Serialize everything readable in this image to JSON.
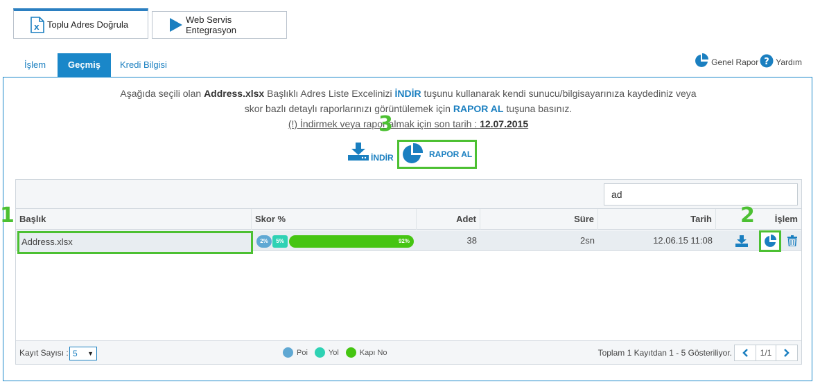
{
  "top_buttons": {
    "bulk_label": "Toplu Adres Doğrula",
    "webservice_label": "Web Servis Entegrasyon"
  },
  "tabs": [
    {
      "label": "İşlem"
    },
    {
      "label": "Geçmiş",
      "active": true
    },
    {
      "label": "Kredi Bilgisi"
    }
  ],
  "top_right": {
    "general_report": "Genel Rapor",
    "help": "Yardım"
  },
  "info": {
    "line1_a": "Aşağıda seçili olan ",
    "line1_file": "Address.xlsx",
    "line1_b": " Başlıklı Adres Liste Excelinizi ",
    "line1_indir": "İNDİR",
    "line1_c": " tuşunu kullanarak kendi sunucu/bilgisayarınıza kaydediniz veya",
    "line2_a": "skor bazlı detaylı raporlarınızı görüntülemek için ",
    "line2_rapor": "RAPOR AL",
    "line2_b": " tuşuna basınız.",
    "line3_a": "(!) İndirmek veya rapor almak için son tarih : ",
    "line3_date": "12.07.2015"
  },
  "actions": {
    "indir_label": "İNDİR",
    "rapor_label": "RAPOR AL"
  },
  "markers": {
    "one": "1",
    "two": "2",
    "three": "3"
  },
  "search": {
    "value": "ad"
  },
  "table": {
    "headers": {
      "baslik": "Başlık",
      "skor": "Skor %",
      "adet": "Adet",
      "sure": "Süre",
      "tarih": "Tarih",
      "islem": "İşlem"
    },
    "rows": [
      {
        "baslik": "Address.xlsx",
        "poi_pct": "2%",
        "yol_pct": "5%",
        "kapi_pct": "92%",
        "adet": "38",
        "sure": "2sn",
        "tarih": "12.06.15 11:08"
      }
    ]
  },
  "footer": {
    "kayit_label": "Kayıt Sayısı :",
    "kayit_value": "5",
    "legend": [
      {
        "label": "Poi",
        "color": "#5fa8d3"
      },
      {
        "label": "Yol",
        "color": "#2ed2b4"
      },
      {
        "label": "Kapı No",
        "color": "#45c512"
      }
    ],
    "summary": "Toplam 1 Kayıtdan 1 - 5 Gösteriliyor.",
    "page": "1/1"
  },
  "colors": {
    "accent": "#1a87c9",
    "highlight": "#4cc032"
  }
}
